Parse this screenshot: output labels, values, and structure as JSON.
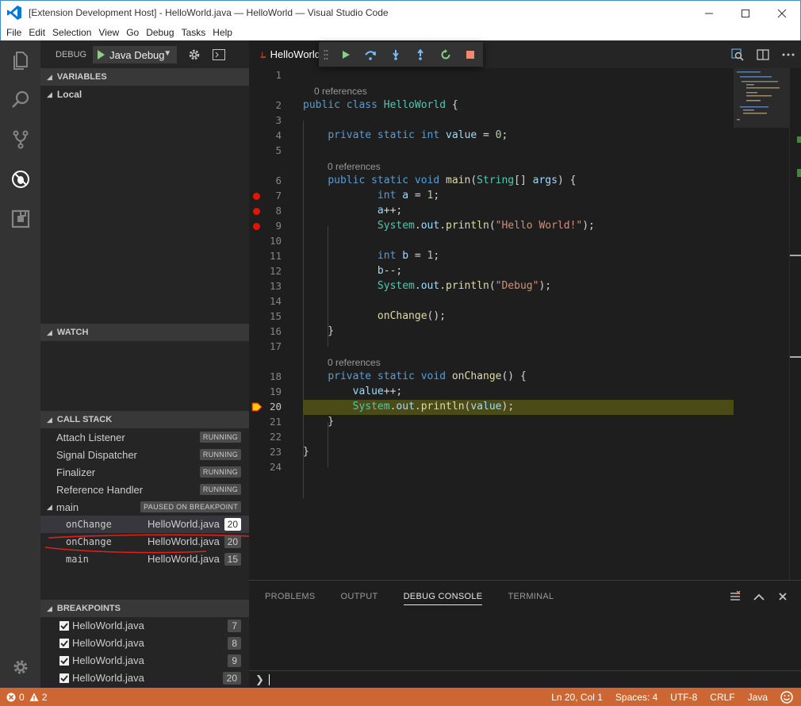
{
  "window": {
    "title": "[Extension Development Host] - HelloWorld.java — HelloWorld — Visual Studio Code"
  },
  "menu": [
    "File",
    "Edit",
    "Selection",
    "View",
    "Go",
    "Debug",
    "Tasks",
    "Help"
  ],
  "activity_bar": [
    "files-icon",
    "search-icon",
    "source-control-icon",
    "debug-icon",
    "extensions-icon",
    "settings-gear-icon"
  ],
  "debug_toolbar": {
    "label": "DEBUG",
    "configuration": "Java Debug"
  },
  "sections": {
    "variables": "VARIABLES",
    "local": "Local",
    "watch": "WATCH",
    "call_stack": "CALL STACK",
    "breakpoints": "BREAKPOINTS"
  },
  "threads": [
    {
      "name": "Attach Listener",
      "status": "RUNNING"
    },
    {
      "name": "Signal Dispatcher",
      "status": "RUNNING"
    },
    {
      "name": "Finalizer",
      "status": "RUNNING"
    },
    {
      "name": "Reference Handler",
      "status": "RUNNING"
    },
    {
      "name": "main",
      "status": "PAUSED ON BREAKPOINT"
    }
  ],
  "frames": [
    {
      "fn": "onChange",
      "file": "HelloWorld.java",
      "line": "20"
    },
    {
      "fn": "onChange",
      "file": "HelloWorld.java",
      "line": "20"
    },
    {
      "fn": "main",
      "file": "HelloWorld.java",
      "line": "15"
    }
  ],
  "breakpoints": [
    {
      "file": "HelloWorld.java",
      "line": "7"
    },
    {
      "file": "HelloWorld.java",
      "line": "8"
    },
    {
      "file": "HelloWorld.java",
      "line": "9"
    },
    {
      "file": "HelloWorld.java",
      "line": "20"
    }
  ],
  "editor": {
    "tab_label": "HelloWorld",
    "code_lens": "0 references",
    "line_numbers": [
      "1",
      "2",
      "3",
      "4",
      "5",
      "6",
      "7",
      "8",
      "9",
      "10",
      "11",
      "12",
      "13",
      "14",
      "15",
      "16",
      "17",
      "18",
      "19",
      "20",
      "21",
      "22",
      "23",
      "24"
    ],
    "current_line": "20"
  },
  "panel": {
    "tabs": [
      "PROBLEMS",
      "OUTPUT",
      "DEBUG CONSOLE",
      "TERMINAL"
    ],
    "active_tab": "DEBUG CONSOLE",
    "prompt": "❯"
  },
  "status": {
    "errors": "0",
    "warnings": "2",
    "position": "Ln 20, Col 1",
    "spaces": "Spaces: 4",
    "encoding": "UTF-8",
    "eol": "CRLF",
    "language": "Java"
  },
  "colors": {
    "status_bar": "#cc6633",
    "breakpoint": "#e51400",
    "current_line_bg": "#4b4b18"
  }
}
